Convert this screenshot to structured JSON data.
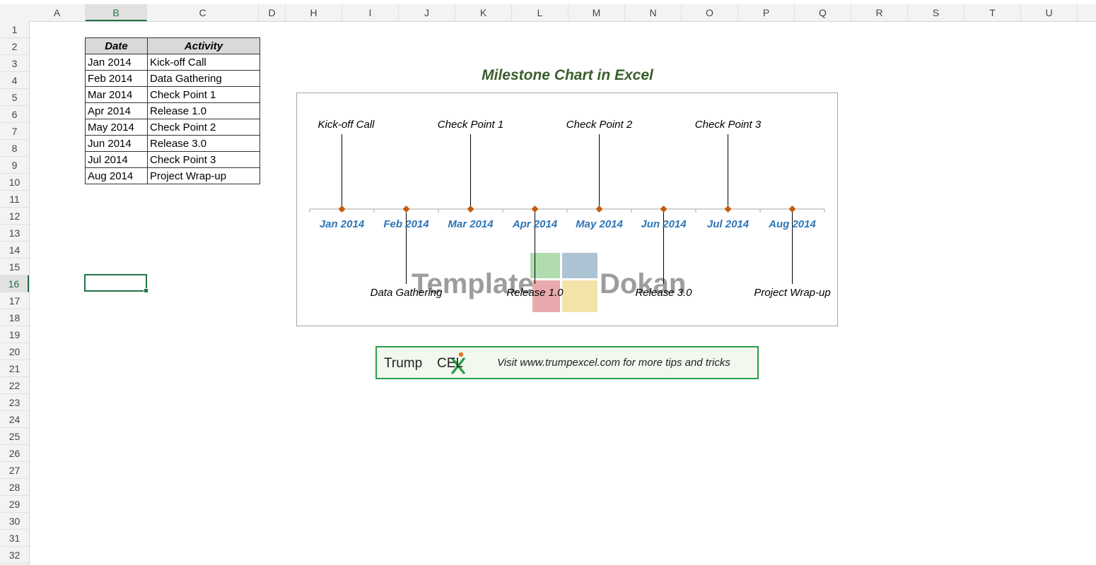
{
  "columns": [
    "A",
    "B",
    "C",
    "D",
    "H",
    "I",
    "J",
    "K",
    "L",
    "M",
    "N",
    "O",
    "P",
    "Q",
    "R",
    "S",
    "T",
    "U"
  ],
  "active_column": "B",
  "rows": [
    "1",
    "2",
    "3",
    "4",
    "5",
    "6",
    "7",
    "8",
    "9",
    "10",
    "11",
    "12",
    "13",
    "14",
    "15",
    "16",
    "17",
    "18",
    "19",
    "20",
    "21",
    "22",
    "23",
    "24",
    "25",
    "26",
    "27",
    "28",
    "29",
    "30",
    "31",
    "32"
  ],
  "active_row": "16",
  "table": {
    "headers": [
      "Date",
      "Activity"
    ],
    "rows": [
      [
        "Jan 2014",
        "Kick-off Call"
      ],
      [
        "Feb 2014",
        "Data Gathering"
      ],
      [
        "Mar 2014",
        "Check Point 1"
      ],
      [
        "Apr 2014",
        "Release 1.0"
      ],
      [
        "May 2014",
        "Check Point 2"
      ],
      [
        "Jun 2014",
        "Release 3.0"
      ],
      [
        "Jul 2014",
        "Check Point 3"
      ],
      [
        "Aug 2014",
        "Project Wrap-up"
      ]
    ]
  },
  "chart_data": {
    "type": "scatter",
    "title": "Milestone Chart in Excel",
    "categories": [
      "Jan 2014",
      "Feb 2014",
      "Mar 2014",
      "Apr 2014",
      "May 2014",
      "Jun 2014",
      "Jul 2014",
      "Aug 2014"
    ],
    "labels": [
      "Kick-off Call",
      "Data Gathering",
      "Check Point 1",
      "Release 1.0",
      "Check Point 2",
      "Release 3.0",
      "Check Point 3",
      "Project Wrap-up"
    ],
    "values": [
      10,
      -10,
      10,
      -10,
      10,
      -10,
      10,
      -10
    ],
    "ylim": [
      -12,
      12
    ],
    "grid": false,
    "legend": "none",
    "colors": {
      "marker": "#c55a11",
      "axis_label": "#2e75b6",
      "stem": "#000000",
      "axis": "#a6a6a6"
    }
  },
  "watermark": {
    "left": "Template",
    "right": "Dokan",
    "colors": [
      "#a9d8a6",
      "#a3bccf",
      "#e6a1a3",
      "#f3e0a0"
    ]
  },
  "banner": {
    "logo_part1": "Trump",
    "logo_part2": "CEL",
    "tagline": "Visit www.trumpexcel.com for more tips and tricks",
    "logo_icon": "excel-x-icon"
  },
  "colors": {
    "accent": "#217346",
    "title": "#3a5f2d",
    "banner_border": "#2a9d4a"
  }
}
